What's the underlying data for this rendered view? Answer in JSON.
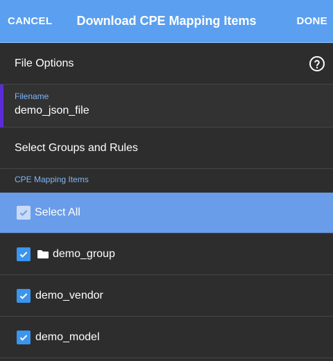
{
  "header": {
    "cancel_label": "CANCEL",
    "title": "Download CPE Mapping Items",
    "done_label": "DONE"
  },
  "file_options": {
    "title": "File Options",
    "help_icon": "help-circle-icon"
  },
  "filename": {
    "label": "Filename",
    "value": "demo_json_file"
  },
  "groups_rules": {
    "title": "Select Groups and Rules"
  },
  "cpe_items": {
    "label": "CPE Mapping Items",
    "select_all": {
      "label": "Select All",
      "checked": true
    },
    "items": [
      {
        "label": "demo_group",
        "icon": "folder-icon",
        "checked": true
      },
      {
        "label": "demo_vendor",
        "checked": true
      },
      {
        "label": "demo_model",
        "checked": true
      }
    ]
  },
  "colors": {
    "header_bg": "#5a9ff0",
    "select_all_bg": "#6a9de9",
    "checkbox": "#3b94ee",
    "field_label": "#7db7f7",
    "focus_bar": "#5b2bd8",
    "panel_bg": "#2d2d2d"
  }
}
